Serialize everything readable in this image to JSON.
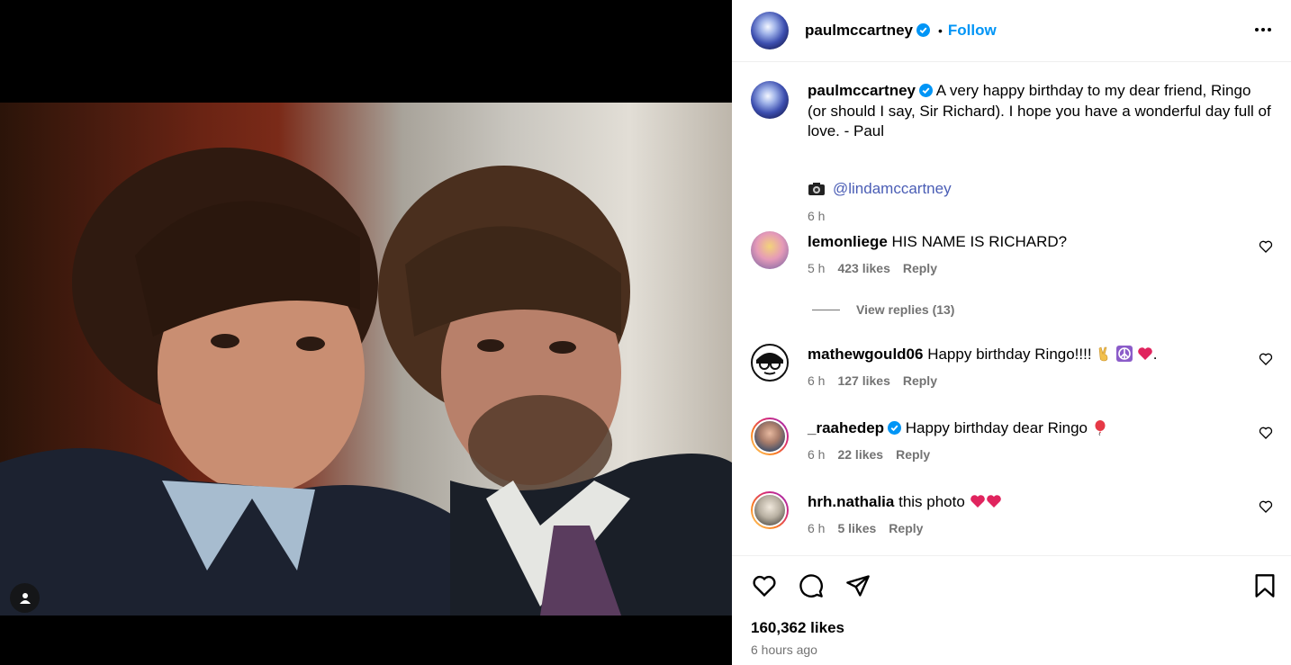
{
  "post": {
    "author": "paulmccartney",
    "follow_label": "Follow",
    "separator": "•",
    "caption": "A very happy birthday to my dear friend, Ringo (or should I say, Sir Richard). I hope you have a wonderful day full of love. - Paul",
    "credit_icon": "camera-icon",
    "credit_mention": "@lindamccartney",
    "caption_time": "6 h"
  },
  "comments": [
    {
      "user": "lemonliege",
      "text": "HIS NAME IS RICHARD?",
      "time": "5 h",
      "likes": "423 likes",
      "reply": "Reply",
      "verified": false
    },
    {
      "user": "mathewgould06",
      "text": "Happy birthday Ringo!!!!",
      "trailing": ".",
      "time": "6 h",
      "likes": "127 likes",
      "reply": "Reply",
      "verified": false
    },
    {
      "user": "_raahedep",
      "text": "Happy birthday dear Ringo",
      "time": "6 h",
      "likes": "22 likes",
      "reply": "Reply",
      "verified": true
    },
    {
      "user": "hrh.nathalia",
      "text": "this photo",
      "time": "6 h",
      "likes": "5 likes",
      "reply": "Reply",
      "verified": false
    }
  ],
  "view_replies": "View replies (13)",
  "footer": {
    "likes": "160,362 likes",
    "posted": "6 hours ago"
  },
  "colors": {
    "accent": "#0095f6",
    "verified": "#0095f6",
    "muted": "#737373",
    "mention": "#4a5db5"
  }
}
